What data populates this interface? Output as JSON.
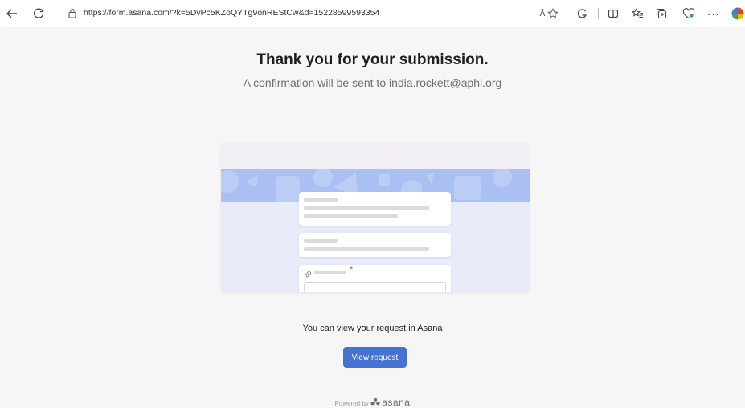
{
  "browser": {
    "url": "https://form.asana.com/?k=5DvPc5KZoQYTg9onREStCw&d=15228599593354",
    "read_aloud_label": "Ă"
  },
  "main": {
    "title": "Thank you for your submission.",
    "subtitle": "A confirmation will be sent to india.rockett@aphl.org",
    "view_text": "You can view your request in Asana",
    "view_button_label": "View request",
    "powered_by": "Powered by",
    "brand": "asana"
  },
  "colors": {
    "accent": "#4573d2",
    "required": "#e8384f",
    "band": "#aabff2"
  },
  "icons": [
    "back-arrow-icon",
    "refresh-icon",
    "lock-icon",
    "read-aloud-icon",
    "favorite-star-icon",
    "copilot-icon",
    "split-screen-icon",
    "favorites-icon",
    "collections-icon",
    "extensions-icon",
    "more-icon",
    "edge-logo-icon",
    "paperclip-icon",
    "asana-logo-icon"
  ]
}
